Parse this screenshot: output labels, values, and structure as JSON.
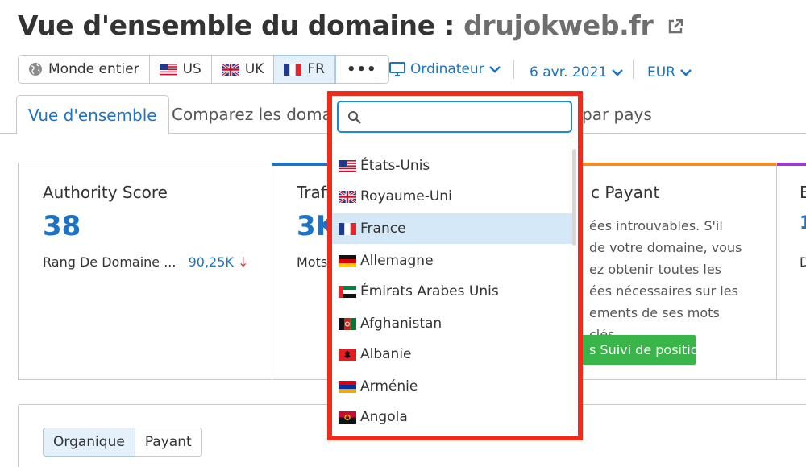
{
  "header": {
    "title_prefix": "Vue d'ensemble du domaine :",
    "domain": "drujokweb.fr"
  },
  "db_buttons": [
    {
      "label": "Monde entier",
      "icon": "globe-icon"
    },
    {
      "label": "US",
      "icon": "flag-us-icon"
    },
    {
      "label": "UK",
      "icon": "flag-uk-icon"
    },
    {
      "label": "FR",
      "icon": "flag-fr-icon"
    },
    {
      "label": "•••",
      "icon": "more-icon"
    }
  ],
  "device": {
    "label": "Ordinateur",
    "icon": "desktop-icon"
  },
  "date": {
    "label": "6 avr. 2021"
  },
  "currency": {
    "label": "EUR"
  },
  "tabs": [
    {
      "label": "Vue d'ensemble"
    },
    {
      "label": "Comparez les domaines"
    },
    {
      "label": "par pays"
    }
  ],
  "cards": {
    "authority": {
      "label": "Authority Score",
      "value": "38",
      "sub_label": "Rang De Domaine ...",
      "sub_value": "90,25K",
      "trend": "↓"
    },
    "traffic": {
      "label": "Trafi",
      "value": "3K",
      "sub_label": "Mots"
    },
    "paid": {
      "label": "c Payant",
      "text": "ées introuvables. S'il de votre domaine, vous ez obtenir toutes les ées nécessaires sur les ements de ses mots clés.",
      "button": "s Suivi de position"
    },
    "fourth": {
      "label": "E",
      "value": "1",
      "sub": "D"
    }
  },
  "segment": {
    "organic": "Organique",
    "paid": "Payant"
  },
  "dropdown": {
    "search_placeholder": "",
    "items": [
      {
        "label": "États-Unis",
        "flag": "us"
      },
      {
        "label": "Royaume-Uni",
        "flag": "uk"
      },
      {
        "label": "France",
        "flag": "fr",
        "selected": true
      },
      {
        "label": "Allemagne",
        "flag": "de"
      },
      {
        "label": "Émirats Arabes Unis",
        "flag": "ae"
      },
      {
        "label": "Afghanistan",
        "flag": "af"
      },
      {
        "label": "Albanie",
        "flag": "al"
      },
      {
        "label": "Arménie",
        "flag": "am"
      },
      {
        "label": "Angola",
        "flag": "ao"
      }
    ]
  },
  "colors": {
    "accent": "#1a73c6",
    "highlight_border": "#f22a1a",
    "green": "#3ab54a",
    "traffic_bar": "#1a73c6",
    "paid_bar": "#f58a2b",
    "fourth_bar": "#9b3cc8"
  }
}
